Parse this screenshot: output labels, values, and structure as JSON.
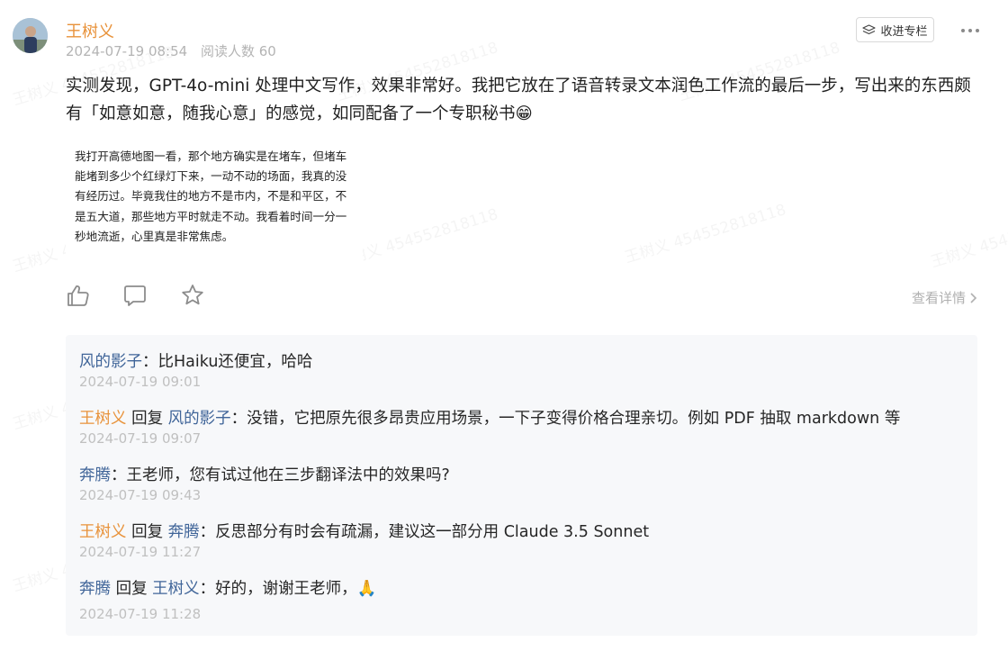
{
  "post": {
    "author": "王树义",
    "date": "2024-07-19 08:54",
    "reads": "阅读人数 60",
    "text": "实测发现，GPT-4o-mini 处理中文写作，效果非常好。我把它放在了语音转录文本润色工作流的最后一步，写出来的东西颇有「如意如意，随我心意」的感觉，如同配备了一个专职秘书😁",
    "collect_label": "收进专栏",
    "detail_label": "查看详情",
    "image_text": "我打开高德地图一看，那个地方确实是在堵车，但堵车能堵到多少个红绿灯下来，一动不动的场面，我真的没有经历过。毕竟我住的地方不是市内，不是和平区，不是五大道，那些地方平时就走不动。我看着时间一分一秒地流逝，心里真是非常焦虑。"
  },
  "watermark": "王树义 454552818118",
  "icons": {
    "like": "thumbs-up-icon",
    "comment": "comment-icon",
    "star": "star-icon",
    "more": "more-dots-icon",
    "collect": "collect-column-icon",
    "chevron": "chevron-right-icon"
  },
  "colors": {
    "author": "#e8923a",
    "user": "#406599",
    "meta": "#b4b4b4",
    "comment_bg": "#f7f8fa"
  },
  "comments": [
    {
      "user": "风的影子",
      "sep": "：",
      "text": "比Haiku还便宜，哈哈",
      "time": "2024-07-19 09:01"
    },
    {
      "user": "王树义",
      "reply_word": "回复",
      "reply_to": "风的影子",
      "sep": "：",
      "text": "没错，它把原先很多昂贵应用场景，一下子变得价格合理亲切。例如 PDF 抽取 markdown 等",
      "time": "2024-07-19 09:07"
    },
    {
      "user": "奔腾",
      "sep": "：",
      "text": "王老师，您有试过他在三步翻译法中的效果吗?",
      "time": "2024-07-19 09:43"
    },
    {
      "user": "王树义",
      "reply_word": "回复",
      "reply_to": "奔腾",
      "sep": "：",
      "text": "反思部分有时会有疏漏，建议这一部分用 Claude 3.5 Sonnet",
      "time": "2024-07-19 11:27"
    },
    {
      "user": "奔腾",
      "reply_word": "回复",
      "reply_to": "王树义",
      "sep": "：",
      "text": "好的，谢谢王老师，🙏",
      "time": "2024-07-19 11:28"
    }
  ]
}
